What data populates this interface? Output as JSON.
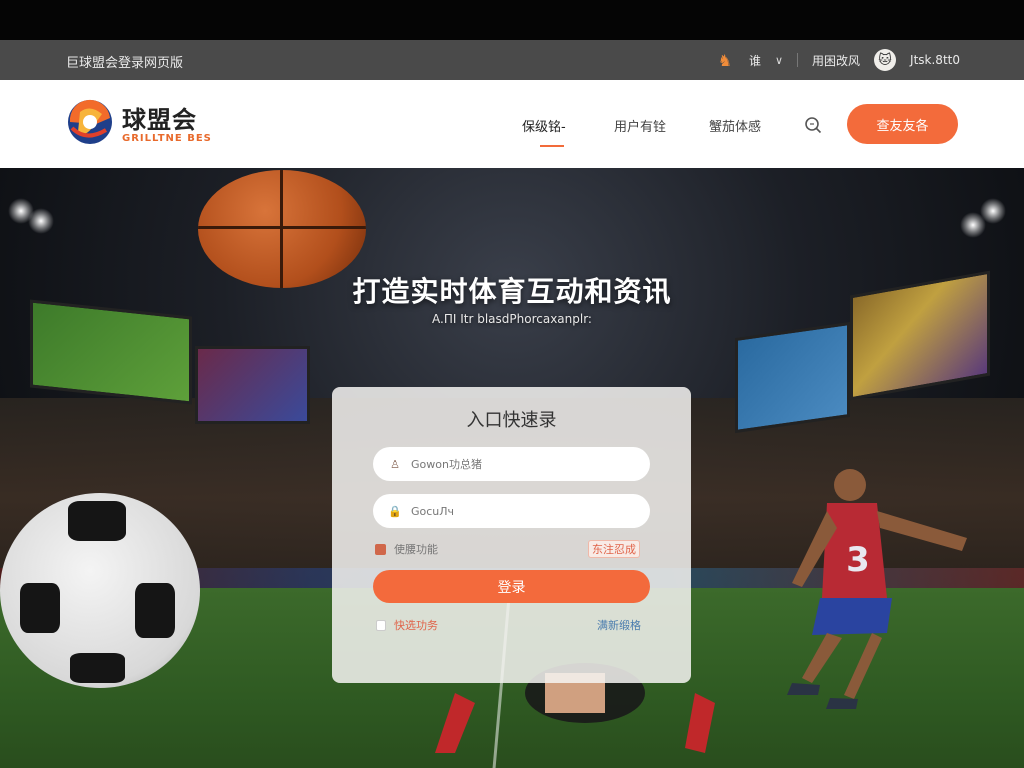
{
  "util_bar": {
    "left_text": "巨球盟会登录网页版",
    "lang_label": "谁",
    "user_label": "用困改风",
    "account_label": "Jtsk.8tt0"
  },
  "header": {
    "logo_cn": "球盟会",
    "logo_en": "GRILLTNE BES",
    "nav": [
      "保级铭-",
      "用户有铨",
      "蟹茄体感"
    ],
    "cta_label": "查友友各"
  },
  "hero": {
    "title": "打造实时体育互动和资讯",
    "subtitle": "A.ПI Itr blasdPhorcaxanplr:"
  },
  "login": {
    "title": "入口快速录",
    "username_placeholder": "Gowon功总猪",
    "password_placeholder": "GocuЛч",
    "remember_label": "使腰功能",
    "forgot_label": "东注忍成",
    "submit_label": "登录",
    "bottom_left_label": "快选功务",
    "bottom_right_label": "满新缎格"
  },
  "icons": {
    "horse": "horse-icon",
    "chevron": "chevron-down-icon",
    "avatar": "cat-avatar-icon",
    "search": "search-icon",
    "user": "user-icon",
    "lock": "lock-icon"
  },
  "colors": {
    "accent": "#f36b3b",
    "util_bar": "#4a4a4a",
    "link_blue": "#4a7cae"
  }
}
